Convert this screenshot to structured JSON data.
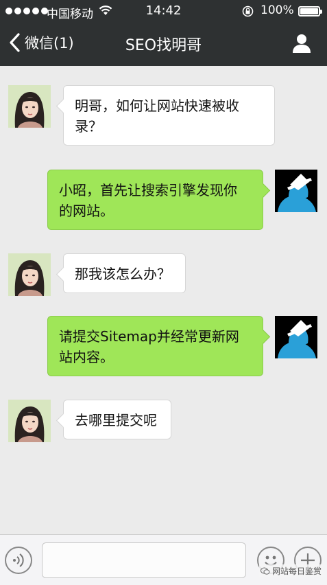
{
  "status_bar": {
    "carrier": "中国移动",
    "time": "14:42",
    "battery_percent": "100%",
    "battery_level": 1.0,
    "icons": [
      "signal-dots-icon",
      "wifi-icon",
      "rotation-lock-icon",
      "battery-icon"
    ]
  },
  "nav": {
    "back_label": "微信(1)",
    "title": "SEO找明哥",
    "icons": [
      "chevron-left-icon",
      "profile-icon"
    ]
  },
  "messages": [
    {
      "side": "left",
      "text": "明哥，如何让网站快速被收录？"
    },
    {
      "side": "right",
      "text": "小昭，首先让搜索引擎发现你的网站。"
    },
    {
      "side": "left",
      "text": "那我该怎么办？"
    },
    {
      "side": "right",
      "text": "请提交Sitemap并经常更新网站内容。"
    },
    {
      "side": "left",
      "text": "去哪里提交呢"
    }
  ],
  "input_bar": {
    "text_value": "",
    "icons": [
      "voice-icon",
      "emoji-icon",
      "plus-icon"
    ],
    "watermark": "网站每日鉴赏"
  },
  "colors": {
    "header_bg": "#2e3132",
    "chat_bg": "#ebebeb",
    "bubble_sent": "#9fe658",
    "bubble_received": "#ffffff"
  }
}
